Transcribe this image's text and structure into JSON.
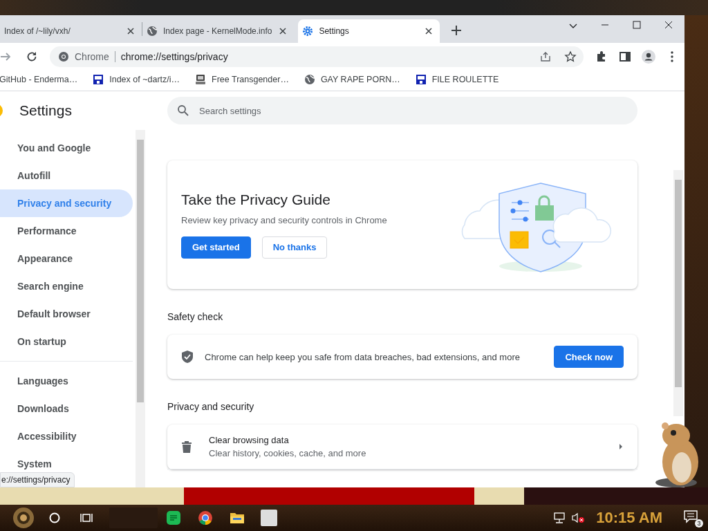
{
  "tabs": [
    {
      "title": "Index of /~lily/vxh/",
      "selected": false
    },
    {
      "title": "Index page - KernelMode.info",
      "selected": false
    },
    {
      "title": "Settings",
      "selected": true
    }
  ],
  "address_bar": {
    "site_label": "Chrome",
    "url": "chrome://settings/privacy"
  },
  "bookmarks": [
    {
      "title": "GitHub - Enderma…"
    },
    {
      "title": "Index of ~dartz/i…"
    },
    {
      "title": "Free Transgender…"
    },
    {
      "title": "GAY RAPE PORN…"
    },
    {
      "title": "FILE ROULETTE"
    }
  ],
  "settings": {
    "title": "Settings",
    "search_placeholder": "Search settings"
  },
  "nav": [
    {
      "items": [
        {
          "label": "You and Google",
          "selected": false
        },
        {
          "label": "Autofill",
          "selected": false
        },
        {
          "label": "Privacy and security",
          "selected": true
        },
        {
          "label": "Performance",
          "selected": false
        },
        {
          "label": "Appearance",
          "selected": false
        },
        {
          "label": "Search engine",
          "selected": false
        },
        {
          "label": "Default browser",
          "selected": false
        },
        {
          "label": "On startup",
          "selected": false
        }
      ]
    },
    {
      "items": [
        {
          "label": "Languages",
          "selected": false
        },
        {
          "label": "Downloads",
          "selected": false
        },
        {
          "label": "Accessibility",
          "selected": false
        },
        {
          "label": "System",
          "selected": false
        }
      ]
    }
  ],
  "privacy_guide": {
    "title": "Take the Privacy Guide",
    "description": "Review key privacy and security controls in Chrome",
    "buttons": [
      {
        "label": "Get started",
        "kind": "primary"
      },
      {
        "label": "No thanks",
        "kind": "secondary"
      }
    ]
  },
  "safety_check": {
    "heading": "Safety check",
    "text": "Chrome can help keep you safe from data breaches, bad extensions, and more",
    "button": "Check now"
  },
  "privacy_section": {
    "heading": "Privacy and security",
    "rows": [
      {
        "title": "Clear browsing data",
        "subtitle": "Clear history, cookies, cache, and more"
      }
    ]
  },
  "status_bubble": "e://settings/privacy",
  "taskbar": {
    "clock": "10:15 AM",
    "notification_count": "3"
  }
}
